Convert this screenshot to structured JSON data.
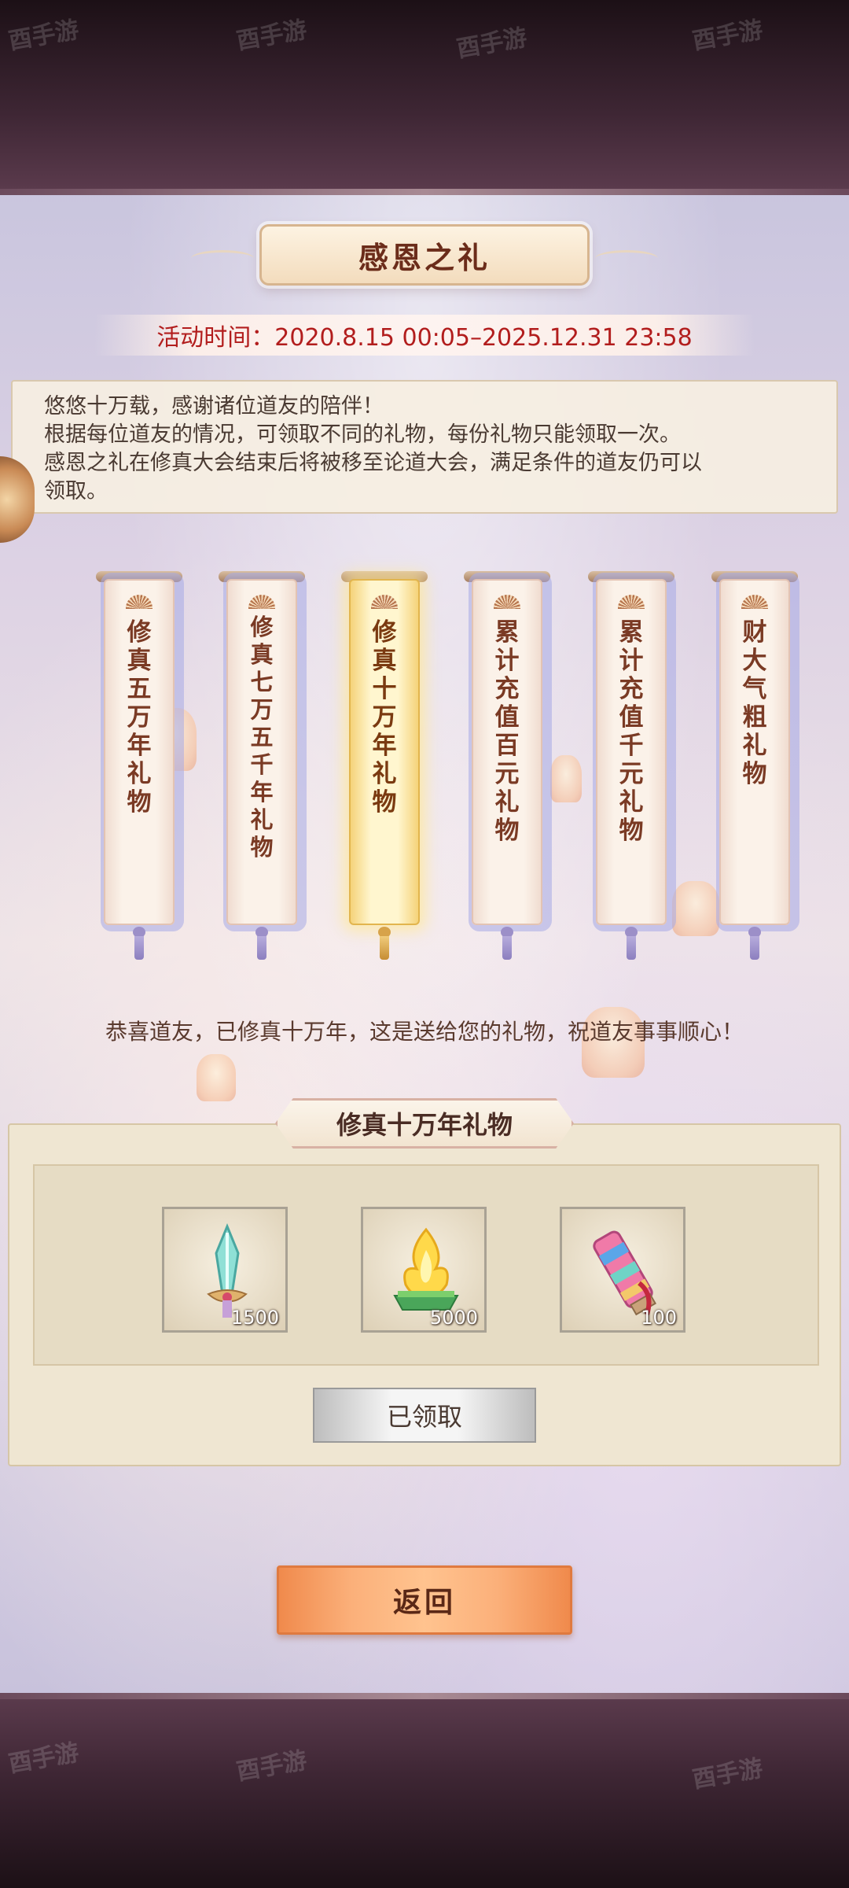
{
  "header": {
    "title": "感恩之礼"
  },
  "event_time": "活动时间：2020.8.15 00:05–2025.12.31 23:58",
  "description": [
    "悠悠十万载，感谢诸位道友的陪伴！",
    "根据每位道友的情况，可领取不同的礼物，每份礼物只能领取一次。",
    "感恩之礼在修真大会结束后将被移至论道大会，满足条件的道友仍可以",
    "领取。"
  ],
  "scrolls": [
    {
      "label": "修真五万年礼物",
      "active": false
    },
    {
      "label": "修真七万五千年礼物",
      "active": false
    },
    {
      "label": "修真十万年礼物",
      "active": true
    },
    {
      "label": "累计充值百元礼物",
      "active": false
    },
    {
      "label": "累计充值千元礼物",
      "active": false
    },
    {
      "label": "财大气粗礼物",
      "active": false
    }
  ],
  "congrats_message": "恭喜道友，已修真十万年，这是送给您的礼物，祝道友事事顺心！",
  "reward": {
    "title": "修真十万年礼物",
    "items": [
      {
        "icon": "jade-sword-icon",
        "quantity": "1500"
      },
      {
        "icon": "golden-flame-icon",
        "quantity": "5000"
      },
      {
        "icon": "scroll-icon",
        "quantity": "100"
      }
    ],
    "claimed_label": "已领取"
  },
  "back_label": "返回",
  "watermark": "酉手游",
  "colors": {
    "time_text": "#b21d1d",
    "back_button": "#f08a4c",
    "active_scroll": "#f5d37a"
  }
}
